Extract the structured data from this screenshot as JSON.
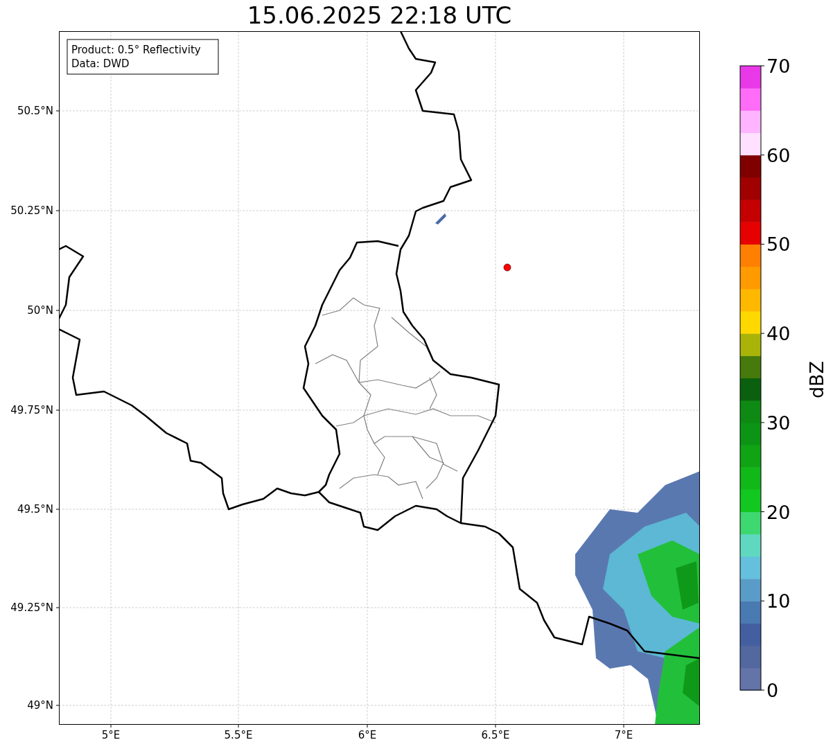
{
  "title": "15.06.2025 22:18 UTC",
  "legend": [
    "Product: 0.5° Reflectivity",
    "Data: DWD"
  ],
  "axes": {
    "yticks": [
      {
        "label": "50.5°N"
      },
      {
        "label": "50.25°N"
      },
      {
        "label": "50°N"
      },
      {
        "label": "49.75°N"
      },
      {
        "label": "49.5°N"
      },
      {
        "label": "49.25°N"
      },
      {
        "label": "49°N"
      }
    ],
    "xticks": [
      {
        "label": "5°E"
      },
      {
        "label": "5.5°E"
      },
      {
        "label": "6°E"
      },
      {
        "label": "6.5°E"
      },
      {
        "label": "7°E"
      }
    ]
  },
  "colorbar": {
    "label": "dBZ",
    "ticks": [
      "70",
      "60",
      "50",
      "40",
      "30",
      "20",
      "10",
      "0"
    ],
    "bands": [
      {
        "color": "#6473a8"
      },
      {
        "color": "#53689f"
      },
      {
        "color": "#435fa0"
      },
      {
        "color": "#4a7ab2"
      },
      {
        "color": "#5a9cc8"
      },
      {
        "color": "#64c0dc"
      },
      {
        "color": "#60d8c0"
      },
      {
        "color": "#3ed870"
      },
      {
        "color": "#12c820"
      },
      {
        "color": "#10b818"
      },
      {
        "color": "#10a414"
      },
      {
        "color": "#0c9414"
      },
      {
        "color": "#0e8a14"
      },
      {
        "color": "#0a600e"
      },
      {
        "color": "#467a0c"
      },
      {
        "color": "#aab408"
      },
      {
        "color": "#ffd800"
      },
      {
        "color": "#ffb800"
      },
      {
        "color": "#ff9a00"
      },
      {
        "color": "#ff8000"
      },
      {
        "color": "#e60000"
      },
      {
        "color": "#c40000"
      },
      {
        "color": "#a00000"
      },
      {
        "color": "#800000"
      },
      {
        "color": "#ffe0ff"
      },
      {
        "color": "#ffb4ff"
      },
      {
        "color": "#ff6cf8"
      },
      {
        "color": "#e838e8"
      }
    ]
  }
}
